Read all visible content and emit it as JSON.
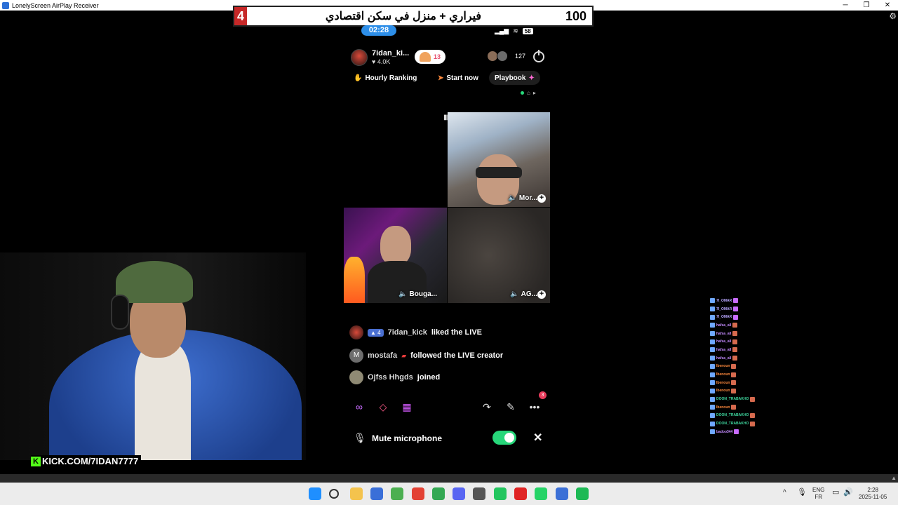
{
  "window": {
    "title": "LonelyScreen AirPlay Receiver",
    "minimize": "─",
    "maximize": "❐",
    "close": "✕"
  },
  "banner": {
    "left_number": "4",
    "headline": "فيراري + منزل في سكن اقتصادي",
    "right_number": "100"
  },
  "timer": "02:28",
  "phone_status": {
    "signal": "▂▄▆",
    "wifi": "≋",
    "battery": "58"
  },
  "host": {
    "name": "7idan_ki...",
    "likes": "4.0K",
    "fan_level": "13",
    "viewers": "127"
  },
  "chips": {
    "ranking": "Hourly Ranking",
    "start": "Start now",
    "playbook": "Playbook"
  },
  "tiles": [
    {
      "label": "Mor..."
    },
    {
      "label": "Bouga..."
    },
    {
      "label": "AG..."
    }
  ],
  "feed": [
    {
      "avatar": "",
      "badge": "4",
      "user": "7idan_kick",
      "action": "liked the LIVE"
    },
    {
      "avatar": "M",
      "user": "mostafa",
      "action": "followed the LIVE creator"
    },
    {
      "avatar": "",
      "user": "Ojfss Hhgds",
      "action": "joined"
    }
  ],
  "notification_count": "3",
  "mic": {
    "label": "Mute microphone",
    "enabled": true
  },
  "overlay": {
    "kick_url": "KICK.COM/7IDAN7777",
    "kick_logo": "K"
  },
  "chat_overlay": [
    {
      "user": "7I_OMAR",
      "color": "#b9a7ff",
      "emote": "#c86bff"
    },
    {
      "user": "7I_OMAR",
      "color": "#b9a7ff",
      "emote": "#c86bff"
    },
    {
      "user": "7I_OMAR",
      "color": "#b9a7ff",
      "emote": "#c86bff"
    },
    {
      "user": "hafsa_all",
      "color": "#c58bff",
      "emote": "#d66a4e"
    },
    {
      "user": "hafsa_all",
      "color": "#c58bff",
      "emote": "#d66a4e"
    },
    {
      "user": "hafsa_all",
      "color": "#c58bff",
      "emote": "#d66a4e"
    },
    {
      "user": "hafsa_all",
      "color": "#c58bff",
      "emote": "#d66a4e"
    },
    {
      "user": "hafsa_all",
      "color": "#c58bff",
      "emote": "#d66a4e"
    },
    {
      "user": "Ibenoun",
      "color": "#ff8a3d",
      "emote": "#d66a4e"
    },
    {
      "user": "Ibenoun",
      "color": "#ff8a3d",
      "emote": "#d66a4e"
    },
    {
      "user": "Ibenoun",
      "color": "#ff8a3d",
      "emote": "#d66a4e"
    },
    {
      "user": "Ibenoun",
      "color": "#ff8a3d",
      "emote": "#d66a4e"
    },
    {
      "user": "DOON_TRABAKHO",
      "color": "#3fd9a0",
      "emote": "#d66a4e"
    },
    {
      "user": "Ibenoun",
      "color": "#ff8a3d",
      "emote": "#d66a4e"
    },
    {
      "user": "DOON_TRABAKHO",
      "color": "#3fd9a0",
      "emote": "#d66a4e"
    },
    {
      "user": "DOON_TRABAKHO",
      "color": "#3fd9a0",
      "emote": "#d66a4e"
    },
    {
      "user": "badoo344",
      "color": "#c58bff",
      "emote": "#c86bff"
    }
  ],
  "taskbar": {
    "apps": [
      {
        "name": "windows-start-icon",
        "color": "#1f8fff"
      },
      {
        "name": "search-icon",
        "color": "#333333"
      },
      {
        "name": "file-explorer-icon",
        "color": "#f4c34d"
      },
      {
        "name": "store-icon",
        "color": "#3a6fd8"
      },
      {
        "name": "layers-app-icon",
        "color": "#4caf50"
      },
      {
        "name": "chrome-icon",
        "color": "#e34133"
      },
      {
        "name": "chrome-profile-icon",
        "color": "#34a853"
      },
      {
        "name": "discord-icon",
        "color": "#5865f2"
      },
      {
        "name": "obs-icon",
        "color": "#555555"
      },
      {
        "name": "play-icon",
        "color": "#22c55e"
      },
      {
        "name": "youtube-icon",
        "color": "#e02424"
      },
      {
        "name": "whatsapp-icon",
        "color": "#25d366"
      },
      {
        "name": "lonelyscreen-icon",
        "color": "#3b6fd6"
      },
      {
        "name": "spotify-icon",
        "color": "#1db954"
      }
    ],
    "tray_caret": "^",
    "lang_top": "ENG",
    "lang_bottom": "FR",
    "time": "2:28",
    "date": "2025-11-05"
  }
}
